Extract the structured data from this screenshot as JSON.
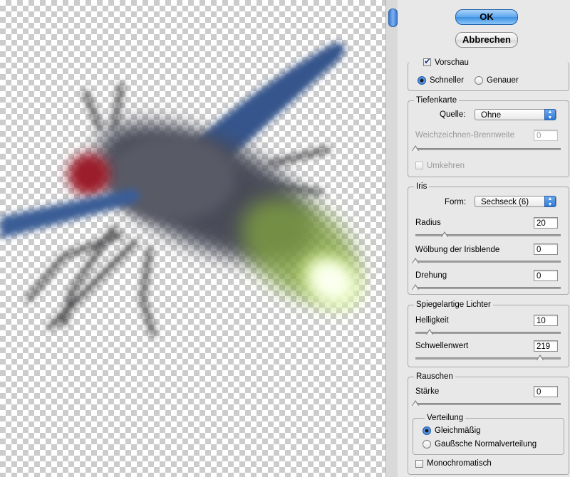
{
  "buttons": {
    "ok": "OK",
    "cancel": "Abbrechen"
  },
  "preview": {
    "checkbox_label": "Vorschau",
    "checked": true,
    "options": [
      "Schneller",
      "Genauer"
    ],
    "selected": "Schneller"
  },
  "depth_map": {
    "title": "Tiefenkarte",
    "source_label": "Quelle:",
    "source_value": "Ohne",
    "focal_label": "Weichzeichnen-Brennweite",
    "focal_value": "0",
    "invert_label": "Umkehren",
    "invert_checked": false
  },
  "iris": {
    "title": "Iris",
    "shape_label": "Form:",
    "shape_value": "Sechseck (6)",
    "radius_label": "Radius",
    "radius_value": "20",
    "radius_level": 0.2,
    "curvature_label": "Wölbung der Irisblende",
    "curvature_value": "0",
    "curvature_level": 0,
    "rotation_label": "Drehung",
    "rotation_value": "0",
    "rotation_level": 0
  },
  "specular": {
    "title": "Spiegelartige Lichter",
    "brightness_label": "Helligkeit",
    "brightness_value": "10",
    "brightness_level": 0.1,
    "threshold_label": "Schwellenwert",
    "threshold_value": "219",
    "threshold_level": 0.86
  },
  "noise": {
    "title": "Rauschen",
    "amount_label": "Stärke",
    "amount_value": "0",
    "amount_level": 0,
    "distribution": {
      "title": "Verteilung",
      "options": [
        "Gleichmäßig",
        "Gaußsche Normalverteilung"
      ],
      "selected": "Gleichmäßig"
    },
    "mono_label": "Monochromatisch",
    "mono_checked": false
  },
  "colors": {
    "accent": "#2f79d6",
    "wing": "#3a5d96",
    "eye": "#9b1d2c",
    "glow": "#d6f08a"
  }
}
